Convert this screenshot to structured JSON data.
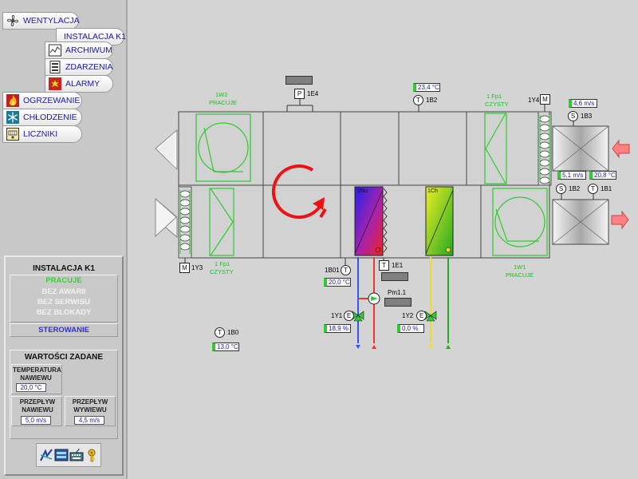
{
  "sidebar": {
    "items": [
      {
        "label": "WENTYLACJA",
        "icon": "fan-icon"
      },
      {
        "label": "INSTALACJA K1"
      },
      {
        "label": "ARCHIWUM",
        "icon": "archive-chart-icon"
      },
      {
        "label": "ZDARZENIA",
        "icon": "events-list-icon"
      },
      {
        "label": "ALARMY",
        "icon": "alarm-icon"
      },
      {
        "label": "OGRZEWANIE",
        "icon": "flame-icon"
      },
      {
        "label": "CHŁODZENIE",
        "icon": "snowflake-icon"
      },
      {
        "label": "LICZNIKI",
        "icon": "counter-icon"
      }
    ]
  },
  "panel": {
    "title": "INSTALACJA K1",
    "status": [
      "PRACUJE",
      "BEZ AWARII",
      "BEZ SERWISU",
      "BEZ BLOKADY"
    ],
    "control": "STEROWANIE",
    "setpoints_title": "WARTOŚCI ZADANE",
    "setpoints": {
      "temp_label": "TEMPERATURA NAWIEWU",
      "temp_value": "20,0 °C",
      "flow_supply_label": "PRZEPŁYW NAWIEWU",
      "flow_supply_value": "5,0 m/s",
      "flow_exhaust_label": "PRZEPŁYW WYWIEWU",
      "flow_exhaust_value": "4,5 m/s"
    }
  },
  "schematic": {
    "fan_top": {
      "tag": "1W2",
      "state": "PRACUJE"
    },
    "fan_bottom": {
      "tag": "1W1",
      "state": "PRACUJE"
    },
    "filter_top": {
      "tag": "1 Fp1",
      "state": "CZYSTY"
    },
    "filter_bottom": {
      "tag": "1 Fp1",
      "state": "CZYSTY"
    },
    "filter_supply": {
      "tag": "1 Fp1",
      "state": "CZYSTY"
    },
    "p_sensor": {
      "letter": "P",
      "tag": "1E4"
    },
    "t_1b2": {
      "letter": "T",
      "tag": "1B2",
      "value": "23,4 °C"
    },
    "m_1y4": {
      "letter": "M",
      "tag": "1Y4"
    },
    "s_1b3": {
      "letter": "S",
      "tag": "1B3",
      "value": "4,6  m/s"
    },
    "s_1b2": {
      "letter": "S",
      "tag": "1B2",
      "value": "5,1  m/s"
    },
    "t_1b1": {
      "letter": "T",
      "tag": "1B1",
      "value": "20,8 °C"
    },
    "m_1y3": {
      "letter": "M",
      "tag": "1Y3"
    },
    "t_1b01": {
      "letter": "T",
      "tag": "1B01",
      "value": "20,0 °C"
    },
    "t_1e1": {
      "letter": "T",
      "tag": "1E1"
    },
    "heater_label": "1Nu",
    "cooler_label": "1Ch",
    "pump": {
      "tag": "Pm1.1"
    },
    "valve_1y1": {
      "letter": "E",
      "tag": "1Y1",
      "value": "18,9 %"
    },
    "valve_1y2": {
      "letter": "E",
      "tag": "1Y2",
      "value": "0,0 %"
    },
    "t_1b0": {
      "letter": "T",
      "tag": "1B0",
      "value": "13,0 °C"
    }
  },
  "colors": {
    "green": "#2ecc2e",
    "wheel_red": "#ee1111",
    "hot": "#ee3333",
    "cold": "#3355ee",
    "chilled": "#eedd22",
    "supply_arrow": "#ff8080"
  }
}
